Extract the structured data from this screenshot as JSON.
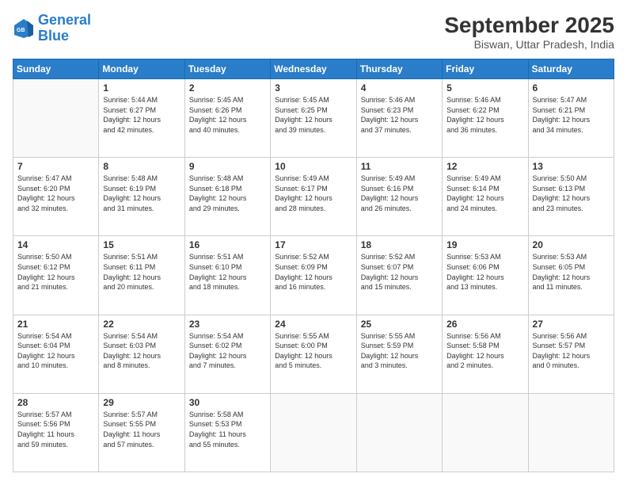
{
  "logo": {
    "line1": "General",
    "line2": "Blue"
  },
  "header": {
    "month": "September 2025",
    "location": "Biswan, Uttar Pradesh, India"
  },
  "weekdays": [
    "Sunday",
    "Monday",
    "Tuesday",
    "Wednesday",
    "Thursday",
    "Friday",
    "Saturday"
  ],
  "weeks": [
    [
      {
        "day": "",
        "text": ""
      },
      {
        "day": "1",
        "text": "Sunrise: 5:44 AM\nSunset: 6:27 PM\nDaylight: 12 hours\nand 42 minutes."
      },
      {
        "day": "2",
        "text": "Sunrise: 5:45 AM\nSunset: 6:26 PM\nDaylight: 12 hours\nand 40 minutes."
      },
      {
        "day": "3",
        "text": "Sunrise: 5:45 AM\nSunset: 6:25 PM\nDaylight: 12 hours\nand 39 minutes."
      },
      {
        "day": "4",
        "text": "Sunrise: 5:46 AM\nSunset: 6:23 PM\nDaylight: 12 hours\nand 37 minutes."
      },
      {
        "day": "5",
        "text": "Sunrise: 5:46 AM\nSunset: 6:22 PM\nDaylight: 12 hours\nand 36 minutes."
      },
      {
        "day": "6",
        "text": "Sunrise: 5:47 AM\nSunset: 6:21 PM\nDaylight: 12 hours\nand 34 minutes."
      }
    ],
    [
      {
        "day": "7",
        "text": "Sunrise: 5:47 AM\nSunset: 6:20 PM\nDaylight: 12 hours\nand 32 minutes."
      },
      {
        "day": "8",
        "text": "Sunrise: 5:48 AM\nSunset: 6:19 PM\nDaylight: 12 hours\nand 31 minutes."
      },
      {
        "day": "9",
        "text": "Sunrise: 5:48 AM\nSunset: 6:18 PM\nDaylight: 12 hours\nand 29 minutes."
      },
      {
        "day": "10",
        "text": "Sunrise: 5:49 AM\nSunset: 6:17 PM\nDaylight: 12 hours\nand 28 minutes."
      },
      {
        "day": "11",
        "text": "Sunrise: 5:49 AM\nSunset: 6:16 PM\nDaylight: 12 hours\nand 26 minutes."
      },
      {
        "day": "12",
        "text": "Sunrise: 5:49 AM\nSunset: 6:14 PM\nDaylight: 12 hours\nand 24 minutes."
      },
      {
        "day": "13",
        "text": "Sunrise: 5:50 AM\nSunset: 6:13 PM\nDaylight: 12 hours\nand 23 minutes."
      }
    ],
    [
      {
        "day": "14",
        "text": "Sunrise: 5:50 AM\nSunset: 6:12 PM\nDaylight: 12 hours\nand 21 minutes."
      },
      {
        "day": "15",
        "text": "Sunrise: 5:51 AM\nSunset: 6:11 PM\nDaylight: 12 hours\nand 20 minutes."
      },
      {
        "day": "16",
        "text": "Sunrise: 5:51 AM\nSunset: 6:10 PM\nDaylight: 12 hours\nand 18 minutes."
      },
      {
        "day": "17",
        "text": "Sunrise: 5:52 AM\nSunset: 6:09 PM\nDaylight: 12 hours\nand 16 minutes."
      },
      {
        "day": "18",
        "text": "Sunrise: 5:52 AM\nSunset: 6:07 PM\nDaylight: 12 hours\nand 15 minutes."
      },
      {
        "day": "19",
        "text": "Sunrise: 5:53 AM\nSunset: 6:06 PM\nDaylight: 12 hours\nand 13 minutes."
      },
      {
        "day": "20",
        "text": "Sunrise: 5:53 AM\nSunset: 6:05 PM\nDaylight: 12 hours\nand 11 minutes."
      }
    ],
    [
      {
        "day": "21",
        "text": "Sunrise: 5:54 AM\nSunset: 6:04 PM\nDaylight: 12 hours\nand 10 minutes."
      },
      {
        "day": "22",
        "text": "Sunrise: 5:54 AM\nSunset: 6:03 PM\nDaylight: 12 hours\nand 8 minutes."
      },
      {
        "day": "23",
        "text": "Sunrise: 5:54 AM\nSunset: 6:02 PM\nDaylight: 12 hours\nand 7 minutes."
      },
      {
        "day": "24",
        "text": "Sunrise: 5:55 AM\nSunset: 6:00 PM\nDaylight: 12 hours\nand 5 minutes."
      },
      {
        "day": "25",
        "text": "Sunrise: 5:55 AM\nSunset: 5:59 PM\nDaylight: 12 hours\nand 3 minutes."
      },
      {
        "day": "26",
        "text": "Sunrise: 5:56 AM\nSunset: 5:58 PM\nDaylight: 12 hours\nand 2 minutes."
      },
      {
        "day": "27",
        "text": "Sunrise: 5:56 AM\nSunset: 5:57 PM\nDaylight: 12 hours\nand 0 minutes."
      }
    ],
    [
      {
        "day": "28",
        "text": "Sunrise: 5:57 AM\nSunset: 5:56 PM\nDaylight: 11 hours\nand 59 minutes."
      },
      {
        "day": "29",
        "text": "Sunrise: 5:57 AM\nSunset: 5:55 PM\nDaylight: 11 hours\nand 57 minutes."
      },
      {
        "day": "30",
        "text": "Sunrise: 5:58 AM\nSunset: 5:53 PM\nDaylight: 11 hours\nand 55 minutes."
      },
      {
        "day": "",
        "text": ""
      },
      {
        "day": "",
        "text": ""
      },
      {
        "day": "",
        "text": ""
      },
      {
        "day": "",
        "text": ""
      }
    ]
  ]
}
